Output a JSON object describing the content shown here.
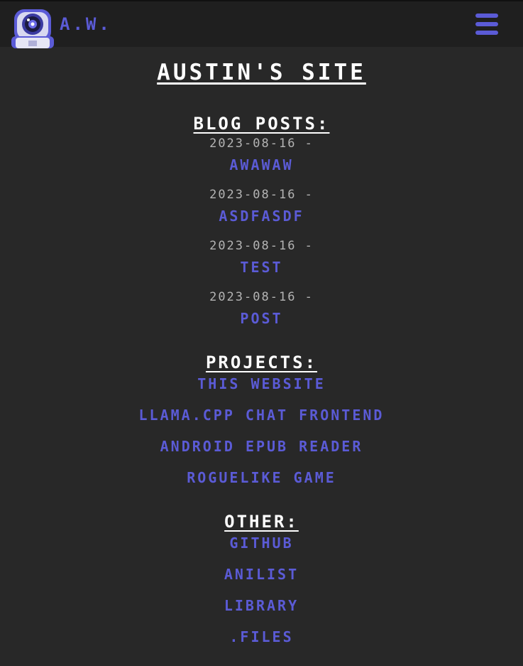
{
  "header": {
    "brand": "A.W.",
    "logo_icon": "astronaut-icon",
    "menu_icon": "hamburger-menu-icon",
    "accent_color": "#5b5bd6"
  },
  "title": "AUSTIN'S SITE",
  "blog": {
    "heading": "BLOG POSTS:",
    "posts": [
      {
        "date": "2023-08-16 -",
        "title": "AWAWAW"
      },
      {
        "date": "2023-08-16 -",
        "title": "ASDFASDF"
      },
      {
        "date": "2023-08-16 -",
        "title": "TEST"
      },
      {
        "date": "2023-08-16 -",
        "title": "POST"
      }
    ]
  },
  "projects": {
    "heading": "PROJECTS:",
    "items": [
      "THIS WEBSITE",
      "LLAMA.CPP CHAT FRONTEND",
      "ANDROID EPUB READER",
      "ROGUELIKE GAME"
    ]
  },
  "other": {
    "heading": "OTHER:",
    "items": [
      "GITHUB",
      "ANILIST",
      "LIBRARY",
      ".FILES"
    ]
  }
}
